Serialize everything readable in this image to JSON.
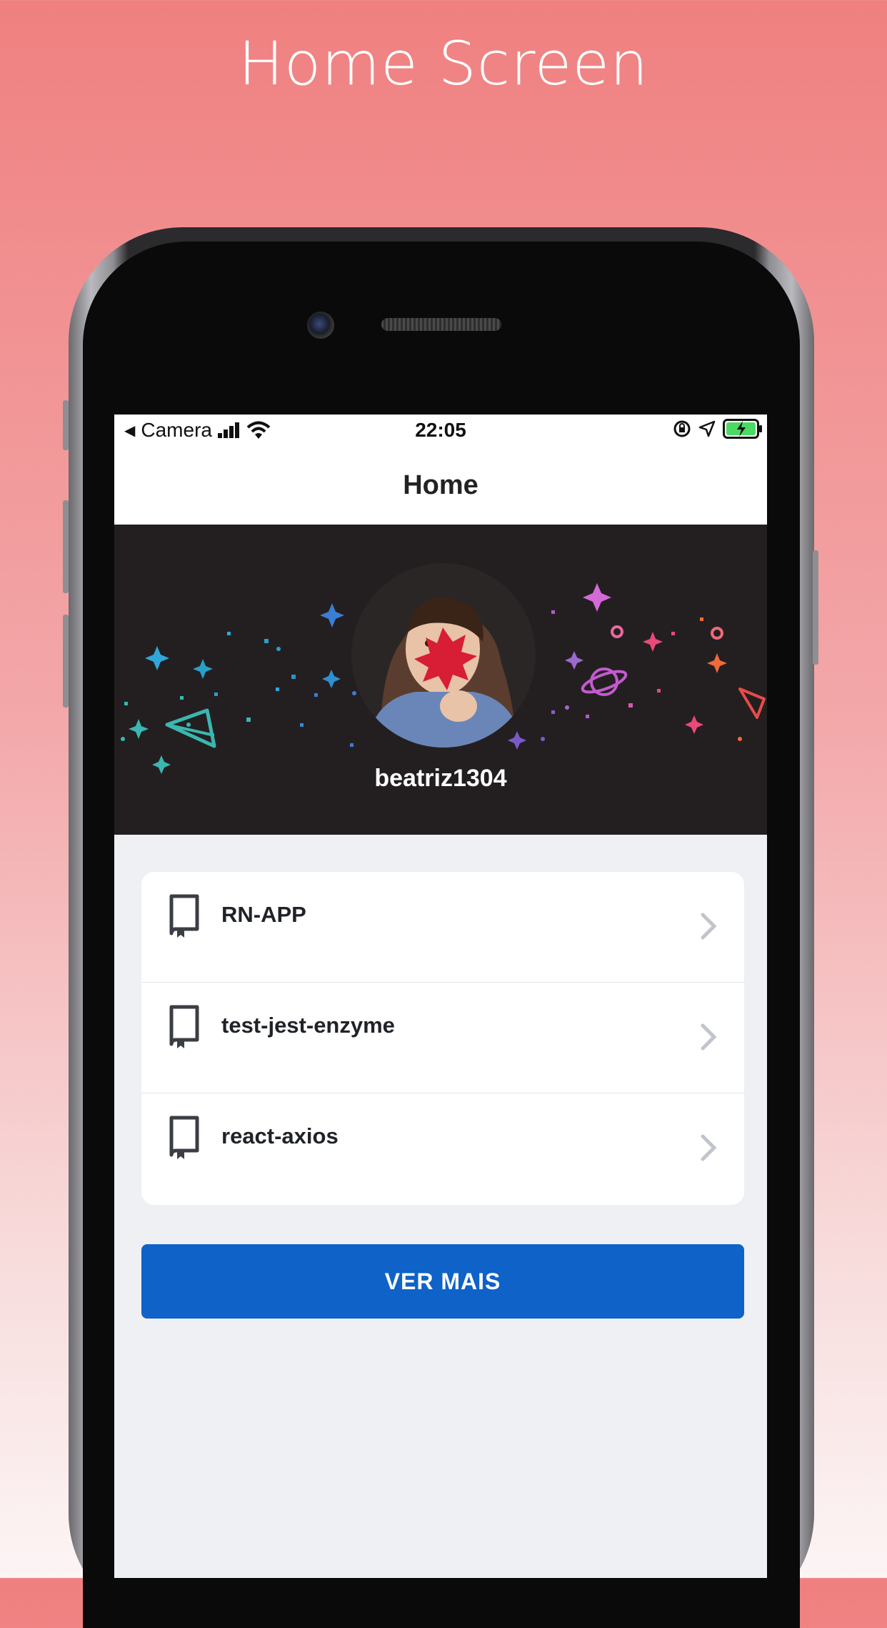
{
  "headline": "Home Screen",
  "status_bar": {
    "back_label": "Camera",
    "time": "22:05",
    "icons": [
      "back-arrow-icon",
      "signal-icon",
      "wifi-icon",
      "orientation-lock-icon",
      "location-icon",
      "battery-charging-icon"
    ]
  },
  "nav": {
    "title": "Home"
  },
  "profile": {
    "username": "beatriz1304"
  },
  "repos": [
    {
      "name": "RN-APP"
    },
    {
      "name": "test-jest-enzyme"
    },
    {
      "name": "react-axios"
    }
  ],
  "button": {
    "label": "VER MAIS"
  },
  "colors": {
    "accent": "#0e62c8",
    "header_bg": "#231f20",
    "screen_bg": "#eef0f4",
    "battery": "#4cd964"
  }
}
